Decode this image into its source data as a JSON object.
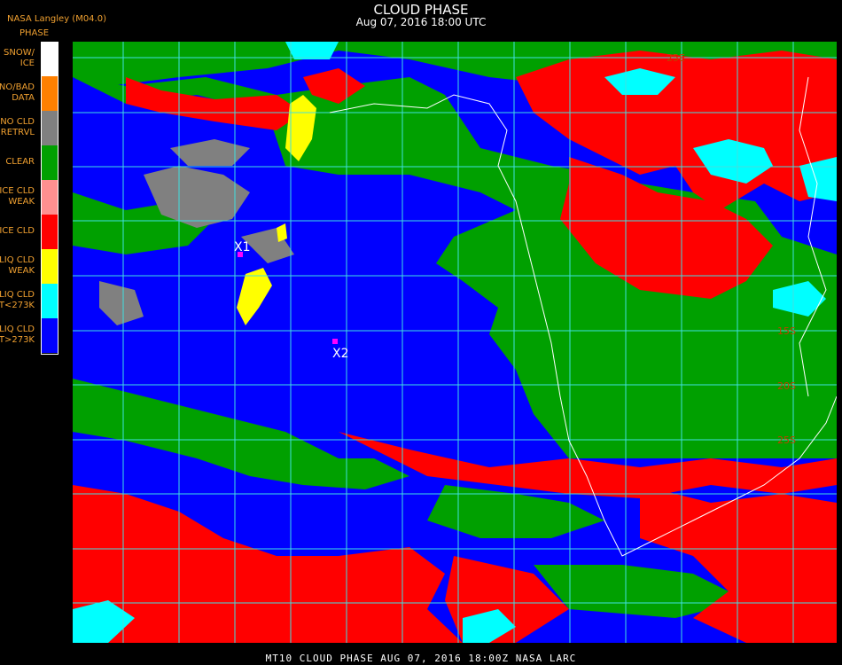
{
  "header": {
    "source": "NASA Langley (M04.0)",
    "legend_heading": "PHASE",
    "title": "CLOUD PHASE",
    "subtitle": "Aug 07, 2016 18:00 UTC"
  },
  "legend": [
    {
      "line1": "SNOW/",
      "line2": "ICE",
      "color": "#ffffff"
    },
    {
      "line1": "NO/BAD",
      "line2": "DATA",
      "color": "#ff8000"
    },
    {
      "line1": "NO CLD",
      "line2": "RETRVL",
      "color": "#808080"
    },
    {
      "line1": "CLEAR",
      "line2": "",
      "color": "#00a000"
    },
    {
      "line1": "ICE CLD",
      "line2": "WEAK",
      "color": "#ff9090"
    },
    {
      "line1": "ICE CLD",
      "line2": "",
      "color": "#ff0000"
    },
    {
      "line1": "LIQ CLD",
      "line2": "WEAK",
      "color": "#ffff00"
    },
    {
      "line1": "LIQ CLD",
      "line2": "T<273K",
      "color": "#00ffff"
    },
    {
      "line1": "LIQ CLD",
      "line2": "T>273K",
      "color": "#0000ff"
    }
  ],
  "markers": [
    {
      "label": "X1",
      "color": "#ff00ff"
    },
    {
      "label": "X2",
      "color": "#ff00ff"
    }
  ],
  "grid_labels": [
    "25E",
    "15S",
    "20S",
    "25S"
  ],
  "colors": {
    "grid": "#40e0e0",
    "coast": "#ffffff",
    "grid_label": "#c04000"
  },
  "footer": "MT10  CLOUD PHASE   AUG 07, 2016 18:00Z   NASA LARC"
}
